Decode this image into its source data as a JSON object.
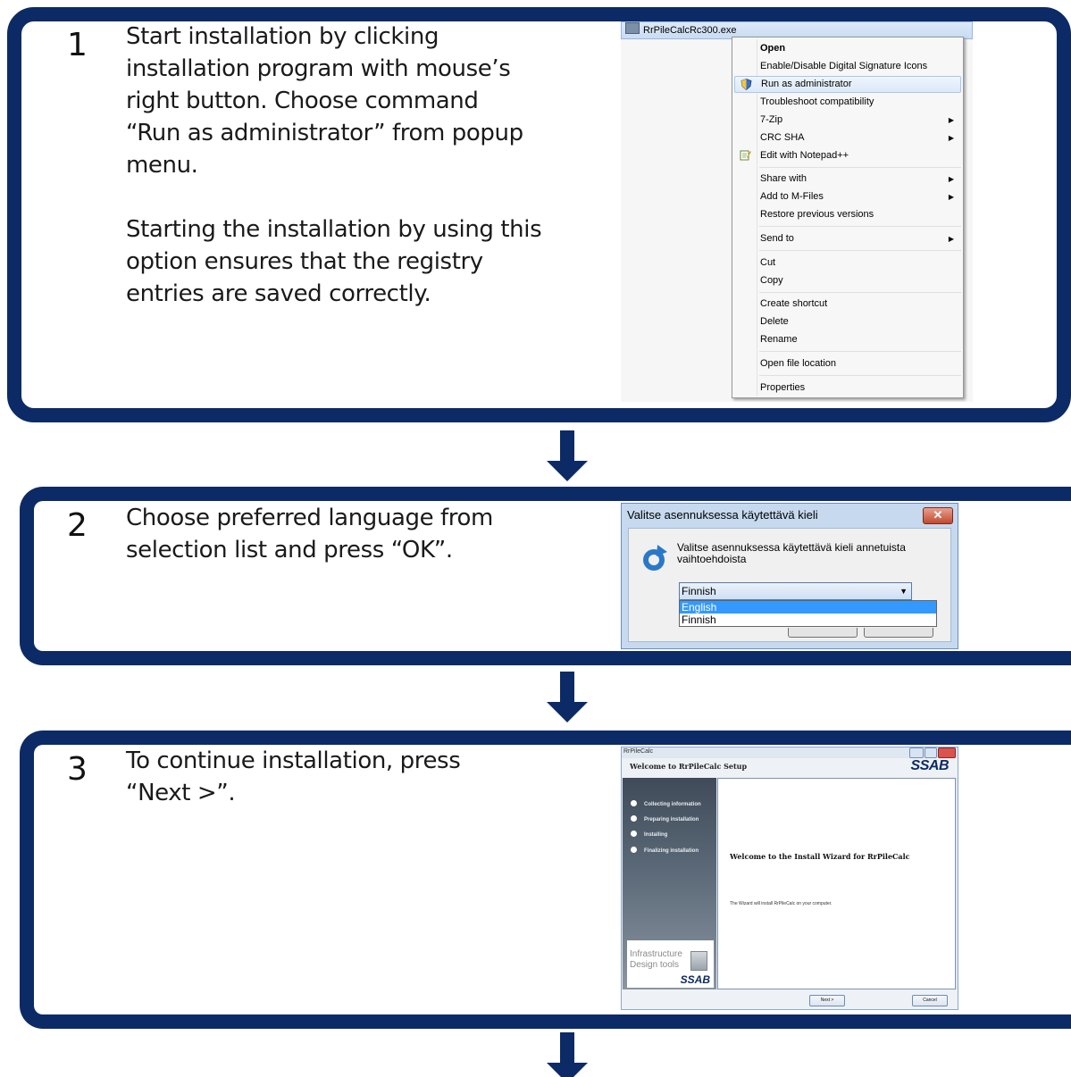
{
  "steps": [
    {
      "number": "1",
      "text": [
        "Start installation by clicking",
        "installation program with mouse’s",
        "right button. Choose command",
        "“Run as administrator” from popup",
        "menu.",
        "",
        "Starting the installation by using this",
        "option ensures that the registry",
        "entries are saved correctly."
      ]
    },
    {
      "number": "2",
      "text": [
        "Choose preferred language from",
        "selection list and press “OK”."
      ]
    },
    {
      "number": "3",
      "text": [
        "To continue installation, press",
        "“Next >”."
      ]
    }
  ],
  "context_menu": {
    "file_name": "RrPileCalcRc300.exe",
    "items": [
      {
        "label": "Open",
        "bold": true
      },
      {
        "label": "Enable/Disable Digital Signature Icons"
      },
      {
        "label": "Run as administrator",
        "highlighted": true,
        "icon": "shield-icon"
      },
      {
        "label": "Troubleshoot compatibility"
      },
      {
        "label": "7-Zip",
        "submenu": true
      },
      {
        "label": "CRC SHA",
        "submenu": true
      },
      {
        "label": "Edit with Notepad++",
        "icon": "notepad-icon"
      },
      {
        "label": "Share with",
        "submenu": true
      },
      {
        "label": "Add to M-Files",
        "submenu": true
      },
      {
        "label": "Restore previous versions"
      },
      {
        "label": "Send to",
        "submenu": true
      },
      {
        "label": "Cut"
      },
      {
        "label": "Copy"
      },
      {
        "label": "Create shortcut"
      },
      {
        "label": "Delete"
      },
      {
        "label": "Rename"
      },
      {
        "label": "Open file location"
      },
      {
        "label": "Properties"
      }
    ]
  },
  "language_dialog": {
    "title": "Valitse asennuksessa käytettävä kieli",
    "close_label": "✕",
    "message": "Valitse asennuksessa käytettävä kieli annetuista vaihtoehdoista",
    "selected": "Finnish",
    "options": [
      {
        "label": "English",
        "selected": true
      },
      {
        "label": "Finnish"
      }
    ]
  },
  "setup_wizard": {
    "window_title": "RrPileCalc",
    "header_title": "Welcome to RrPileCalc Setup",
    "logo": "SSAB",
    "steps": [
      "Collecting information",
      "Preparing installation",
      "Installing",
      "Finalizing installation"
    ],
    "brand_text": [
      "Infrastructure",
      "Design tools"
    ],
    "brand_logo": "SSAB",
    "welcome": "Welcome to the Install Wizard for RrPileCalc",
    "description": "The Wizard will install RrPileCalc on your computer.",
    "next_label": "Next >",
    "cancel_label": "Cancel"
  },
  "colors": {
    "panel_border": "#0c2a66",
    "arrow": "#0c2a66",
    "highlight": "#dde9f8",
    "list_selection": "#3399ff"
  }
}
